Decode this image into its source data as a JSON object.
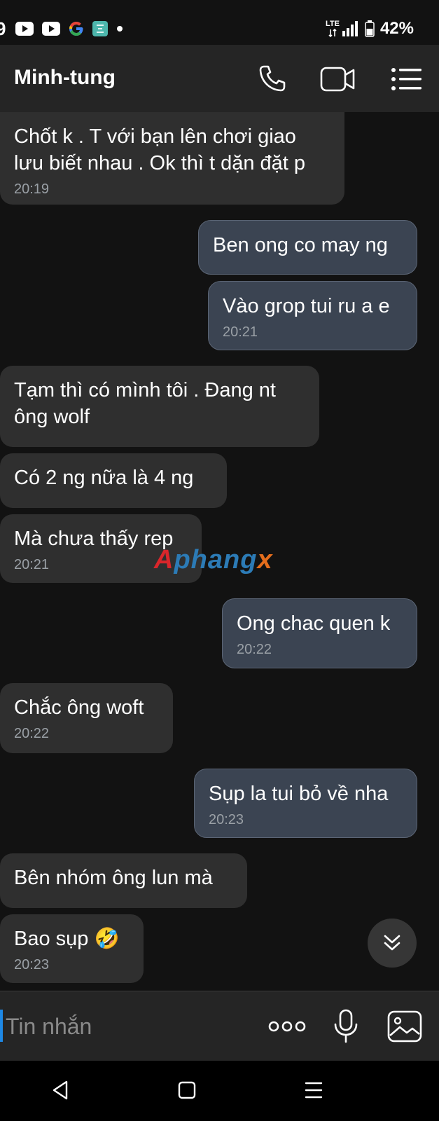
{
  "status_bar": {
    "clock_fragment": "9",
    "network": "LTE",
    "battery": "42%",
    "icons": [
      "youtube-icon",
      "youtube-icon",
      "google-icon",
      "app-icon",
      "dot-icon",
      "lte-icon",
      "signal-icon",
      "battery-icon"
    ]
  },
  "header": {
    "contact_name": "Minh-tung",
    "icons": [
      "phone-icon",
      "video-call-icon",
      "menu-list-icon"
    ]
  },
  "messages": [
    {
      "direction": "incoming",
      "text": "Chốt k . T với bạn lên chơi giao lưu biết nhau . Ok thì t dặn đặt p",
      "time": "20:19"
    },
    {
      "direction": "outgoing",
      "text": "Ben ong co may ng",
      "time": ""
    },
    {
      "direction": "outgoing",
      "text": "Vào grop tui ru a e",
      "time": "20:21"
    },
    {
      "direction": "incoming",
      "text": "Tạm thì có mình tôi . Đang nt ông wolf",
      "time": ""
    },
    {
      "direction": "incoming",
      "text": "Có 2 ng nữa là 4 ng",
      "time": ""
    },
    {
      "direction": "incoming",
      "text": "Mà chưa thấy rep",
      "time": "20:21"
    },
    {
      "direction": "outgoing",
      "text": "Ong chac quen k",
      "time": "20:22"
    },
    {
      "direction": "incoming",
      "text": "Chắc ông woft",
      "time": "20:22"
    },
    {
      "direction": "outgoing",
      "text": "Sụp la tui bỏ về nha",
      "time": "20:23"
    },
    {
      "direction": "incoming",
      "text": "Bên nhóm ông lun mà",
      "time": ""
    },
    {
      "direction": "incoming",
      "text": "Bao sụp 🤣",
      "time": "20:23"
    }
  ],
  "watermark": {
    "part1": "A",
    "part2": "phang",
    "part3": "x"
  },
  "input": {
    "placeholder": "Tin nhắn",
    "icons": [
      "more-options-icon",
      "microphone-icon",
      "image-gallery-icon"
    ]
  },
  "scroll_button": {
    "icon": "chevron-double-down-icon"
  },
  "nav_bar": {
    "icons": [
      "back-icon",
      "home-icon",
      "recents-icon"
    ]
  },
  "colors": {
    "background": "#121212",
    "incoming_bubble": "#2f2f2f",
    "outgoing_bubble": "#3b4452",
    "accent_cursor": "#1e88e5",
    "timestamp": "#9aa0a6"
  }
}
